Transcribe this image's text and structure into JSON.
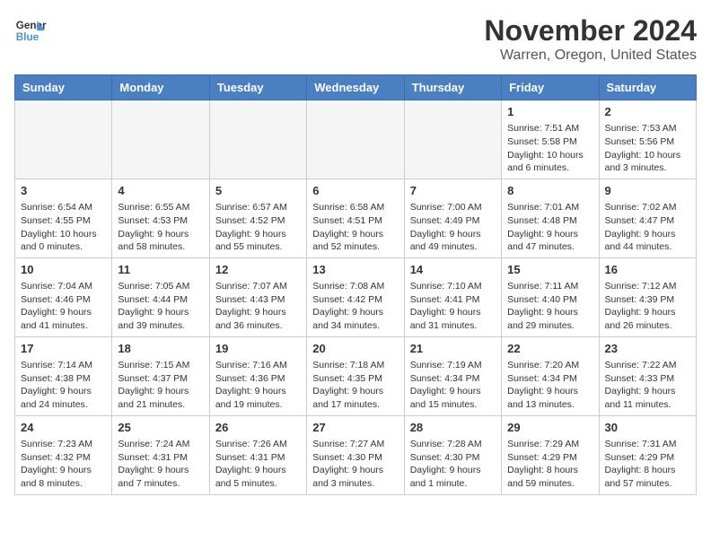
{
  "logo": {
    "line1": "General",
    "line2": "Blue"
  },
  "title": "November 2024",
  "subtitle": "Warren, Oregon, United States",
  "headers": [
    "Sunday",
    "Monday",
    "Tuesday",
    "Wednesday",
    "Thursday",
    "Friday",
    "Saturday"
  ],
  "weeks": [
    [
      {
        "day": "",
        "info": ""
      },
      {
        "day": "",
        "info": ""
      },
      {
        "day": "",
        "info": ""
      },
      {
        "day": "",
        "info": ""
      },
      {
        "day": "",
        "info": ""
      },
      {
        "day": "1",
        "info": "Sunrise: 7:51 AM\nSunset: 5:58 PM\nDaylight: 10 hours and 6 minutes."
      },
      {
        "day": "2",
        "info": "Sunrise: 7:53 AM\nSunset: 5:56 PM\nDaylight: 10 hours and 3 minutes."
      }
    ],
    [
      {
        "day": "3",
        "info": "Sunrise: 6:54 AM\nSunset: 4:55 PM\nDaylight: 10 hours and 0 minutes."
      },
      {
        "day": "4",
        "info": "Sunrise: 6:55 AM\nSunset: 4:53 PM\nDaylight: 9 hours and 58 minutes."
      },
      {
        "day": "5",
        "info": "Sunrise: 6:57 AM\nSunset: 4:52 PM\nDaylight: 9 hours and 55 minutes."
      },
      {
        "day": "6",
        "info": "Sunrise: 6:58 AM\nSunset: 4:51 PM\nDaylight: 9 hours and 52 minutes."
      },
      {
        "day": "7",
        "info": "Sunrise: 7:00 AM\nSunset: 4:49 PM\nDaylight: 9 hours and 49 minutes."
      },
      {
        "day": "8",
        "info": "Sunrise: 7:01 AM\nSunset: 4:48 PM\nDaylight: 9 hours and 47 minutes."
      },
      {
        "day": "9",
        "info": "Sunrise: 7:02 AM\nSunset: 4:47 PM\nDaylight: 9 hours and 44 minutes."
      }
    ],
    [
      {
        "day": "10",
        "info": "Sunrise: 7:04 AM\nSunset: 4:46 PM\nDaylight: 9 hours and 41 minutes."
      },
      {
        "day": "11",
        "info": "Sunrise: 7:05 AM\nSunset: 4:44 PM\nDaylight: 9 hours and 39 minutes."
      },
      {
        "day": "12",
        "info": "Sunrise: 7:07 AM\nSunset: 4:43 PM\nDaylight: 9 hours and 36 minutes."
      },
      {
        "day": "13",
        "info": "Sunrise: 7:08 AM\nSunset: 4:42 PM\nDaylight: 9 hours and 34 minutes."
      },
      {
        "day": "14",
        "info": "Sunrise: 7:10 AM\nSunset: 4:41 PM\nDaylight: 9 hours and 31 minutes."
      },
      {
        "day": "15",
        "info": "Sunrise: 7:11 AM\nSunset: 4:40 PM\nDaylight: 9 hours and 29 minutes."
      },
      {
        "day": "16",
        "info": "Sunrise: 7:12 AM\nSunset: 4:39 PM\nDaylight: 9 hours and 26 minutes."
      }
    ],
    [
      {
        "day": "17",
        "info": "Sunrise: 7:14 AM\nSunset: 4:38 PM\nDaylight: 9 hours and 24 minutes."
      },
      {
        "day": "18",
        "info": "Sunrise: 7:15 AM\nSunset: 4:37 PM\nDaylight: 9 hours and 21 minutes."
      },
      {
        "day": "19",
        "info": "Sunrise: 7:16 AM\nSunset: 4:36 PM\nDaylight: 9 hours and 19 minutes."
      },
      {
        "day": "20",
        "info": "Sunrise: 7:18 AM\nSunset: 4:35 PM\nDaylight: 9 hours and 17 minutes."
      },
      {
        "day": "21",
        "info": "Sunrise: 7:19 AM\nSunset: 4:34 PM\nDaylight: 9 hours and 15 minutes."
      },
      {
        "day": "22",
        "info": "Sunrise: 7:20 AM\nSunset: 4:34 PM\nDaylight: 9 hours and 13 minutes."
      },
      {
        "day": "23",
        "info": "Sunrise: 7:22 AM\nSunset: 4:33 PM\nDaylight: 9 hours and 11 minutes."
      }
    ],
    [
      {
        "day": "24",
        "info": "Sunrise: 7:23 AM\nSunset: 4:32 PM\nDaylight: 9 hours and 8 minutes."
      },
      {
        "day": "25",
        "info": "Sunrise: 7:24 AM\nSunset: 4:31 PM\nDaylight: 9 hours and 7 minutes."
      },
      {
        "day": "26",
        "info": "Sunrise: 7:26 AM\nSunset: 4:31 PM\nDaylight: 9 hours and 5 minutes."
      },
      {
        "day": "27",
        "info": "Sunrise: 7:27 AM\nSunset: 4:30 PM\nDaylight: 9 hours and 3 minutes."
      },
      {
        "day": "28",
        "info": "Sunrise: 7:28 AM\nSunset: 4:30 PM\nDaylight: 9 hours and 1 minute."
      },
      {
        "day": "29",
        "info": "Sunrise: 7:29 AM\nSunset: 4:29 PM\nDaylight: 8 hours and 59 minutes."
      },
      {
        "day": "30",
        "info": "Sunrise: 7:31 AM\nSunset: 4:29 PM\nDaylight: 8 hours and 57 minutes."
      }
    ]
  ]
}
